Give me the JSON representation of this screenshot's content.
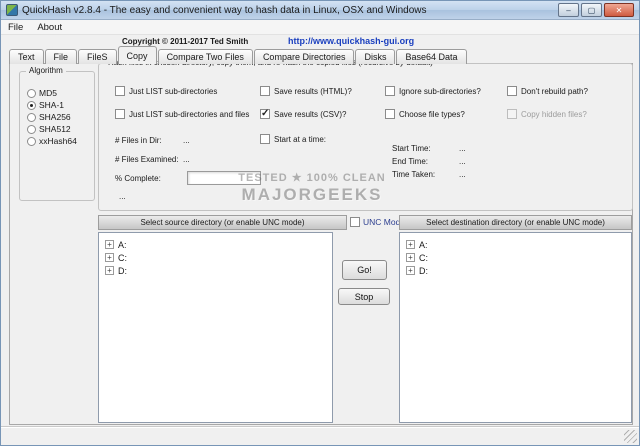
{
  "window": {
    "title": "QuickHash v2.8.4 - The easy and convenient way to hash data in Linux, OSX and Windows"
  },
  "menu": {
    "items": [
      "File",
      "About"
    ]
  },
  "header": {
    "copyright": "Copyright © 2011-2017 Ted Smith",
    "website": "http://www.quickhash-gui.org"
  },
  "tabs": {
    "items": [
      "Text",
      "File",
      "FileS",
      "Copy",
      "Compare Two Files",
      "Compare Directories",
      "Disks",
      "Base64 Data"
    ],
    "active": "Copy"
  },
  "algorithm": {
    "title": "Algorithm",
    "options": [
      "MD5",
      "SHA-1",
      "SHA256",
      "SHA512",
      "xxHash64"
    ],
    "selected": "SHA-1"
  },
  "copy_panel": {
    "title": "Hash files in chosen directory, copy them, and re-hash the copied files (recursive by default)",
    "checkboxes": {
      "just_list_subdirs": {
        "label": "Just LIST sub-directories",
        "checked": false
      },
      "just_list_subdirs_files": {
        "label": "Just LIST sub-directories and files",
        "checked": false
      },
      "save_html": {
        "label": "Save results (HTML)?",
        "checked": false
      },
      "save_csv": {
        "label": "Save results (CSV)?",
        "checked": true
      },
      "ignore_subdirs": {
        "label": "Ignore sub-directories?",
        "checked": false
      },
      "choose_file_types": {
        "label": "Choose file types?",
        "checked": false
      },
      "dont_rebuild_path": {
        "label": "Don't rebuild path?",
        "checked": false
      },
      "copy_hidden_files": {
        "label": "Copy hidden files?",
        "checked": false,
        "disabled": true
      },
      "start_at_time": {
        "label": "Start at a time:",
        "checked": false
      }
    },
    "stats": {
      "files_in_dir": {
        "label": "# Files in Dir:",
        "value": "..."
      },
      "files_examined": {
        "label": "# Files Examined:",
        "value": "..."
      },
      "percent_complete": {
        "label": "% Complete:",
        "value": "..."
      },
      "start_time": {
        "label": "Start Time:",
        "value": "..."
      },
      "end_time": {
        "label": "End Time:",
        "value": "..."
      },
      "time_taken": {
        "label": "Time Taken:",
        "value": "..."
      }
    }
  },
  "source_panel": {
    "header": "Select source directory (or enable UNC mode)",
    "drives": [
      "A:",
      "C:",
      "D:"
    ]
  },
  "unc": {
    "label": "UNC Mode?",
    "checked": false
  },
  "destination_panel": {
    "header": "Select destination directory (or enable UNC mode)",
    "drives": [
      "A:",
      "C:",
      "D:"
    ]
  },
  "actions": {
    "go": "Go!",
    "stop": "Stop"
  },
  "watermark": {
    "line1": "TESTED ★ 100% CLEAN",
    "line2": "MAJORGEEKS"
  }
}
